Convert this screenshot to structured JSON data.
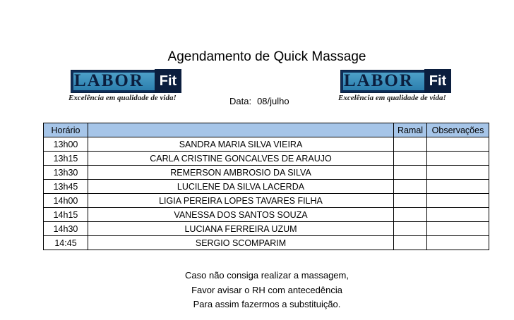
{
  "header": {
    "title": "Agendamento de Quick Massage",
    "date_label": "Data:",
    "date_value": "08/julho"
  },
  "logo": {
    "word": "LABOR",
    "fit": "Fit",
    "tagline": "Excelência em qualidade de vida!",
    "colors": {
      "navy": "#0e2d57",
      "blue": "#2c7fae"
    }
  },
  "table": {
    "columns": [
      "Horário",
      "",
      "Ramal",
      "Observações"
    ],
    "header_color": "#a6c5e8",
    "rows": [
      {
        "time": "13h00",
        "name": "SANDRA MARIA SILVA VIEIRA",
        "ramal": "",
        "obs": ""
      },
      {
        "time": "13h15",
        "name": "CARLA CRISTINE GONCALVES DE ARAUJO",
        "ramal": "",
        "obs": ""
      },
      {
        "time": "13h30",
        "name": "REMERSON AMBROSIO DA SILVA",
        "ramal": "",
        "obs": ""
      },
      {
        "time": "13h45",
        "name": "LUCILENE DA SILVA LACERDA",
        "ramal": "",
        "obs": ""
      },
      {
        "time": "14h00",
        "name": "LIGIA PEREIRA LOPES TAVARES FILHA",
        "ramal": "",
        "obs": ""
      },
      {
        "time": "14h15",
        "name": "VANESSA DOS SANTOS SOUZA",
        "ramal": "",
        "obs": ""
      },
      {
        "time": "14h30",
        "name": "LUCIANA FERREIRA UZUM",
        "ramal": "",
        "obs": ""
      },
      {
        "time": "14:45",
        "name": "SERGIO SCOMPARIM",
        "ramal": "",
        "obs": ""
      }
    ]
  },
  "notes": [
    "Caso não consiga realizar a massagem,",
    "Favor avisar o RH com antecedência",
    "Para assim fazermos a substituição."
  ]
}
